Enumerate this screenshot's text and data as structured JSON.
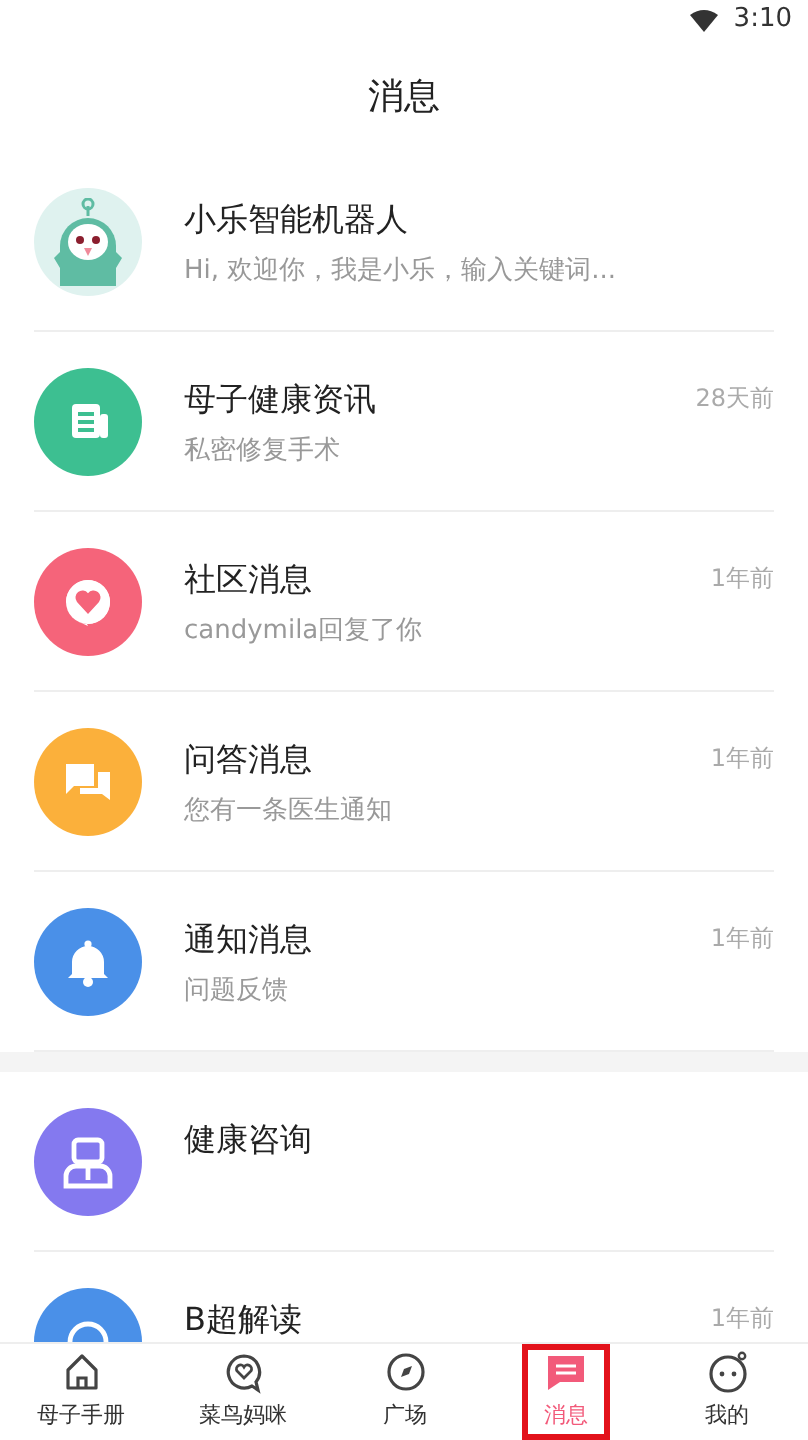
{
  "status_bar": {
    "time": "3:10"
  },
  "title": "消息",
  "messages": [
    {
      "kind": "robot",
      "title": "小乐智能机器人",
      "subtitle": "Hi, 欢迎你，我是小乐，输入关键词..."
    },
    {
      "kind": "news",
      "color": "#3dbf91",
      "title": "母子健康资讯",
      "subtitle": "私密修复手术",
      "time": "28天前"
    },
    {
      "kind": "heart",
      "color": "#f5647a",
      "title": "社区消息",
      "subtitle": "candymila回复了你",
      "time": "1年前"
    },
    {
      "kind": "chat",
      "color": "#fbb03b",
      "title": "问答消息",
      "subtitle": "您有一条医生通知",
      "time": "1年前"
    },
    {
      "kind": "bell",
      "color": "#4a90e8",
      "title": "通知消息",
      "subtitle": "问题反馈",
      "time": "1年前"
    },
    {
      "kind": "section_gap"
    },
    {
      "kind": "doctor",
      "color": "#8479ef",
      "title": "健康咨询"
    },
    {
      "kind": "ultrasound",
      "color": "#4a90e8",
      "title": "B超解读",
      "time": "1年前"
    }
  ],
  "tabs": [
    {
      "kind": "home",
      "label": "母子手册",
      "selected": false
    },
    {
      "kind": "bubble",
      "label": "菜鸟妈咪",
      "selected": false
    },
    {
      "kind": "compass",
      "label": "广场",
      "selected": false
    },
    {
      "kind": "message",
      "label": "消息",
      "selected": true
    },
    {
      "kind": "face",
      "label": "我的",
      "selected": false
    }
  ]
}
